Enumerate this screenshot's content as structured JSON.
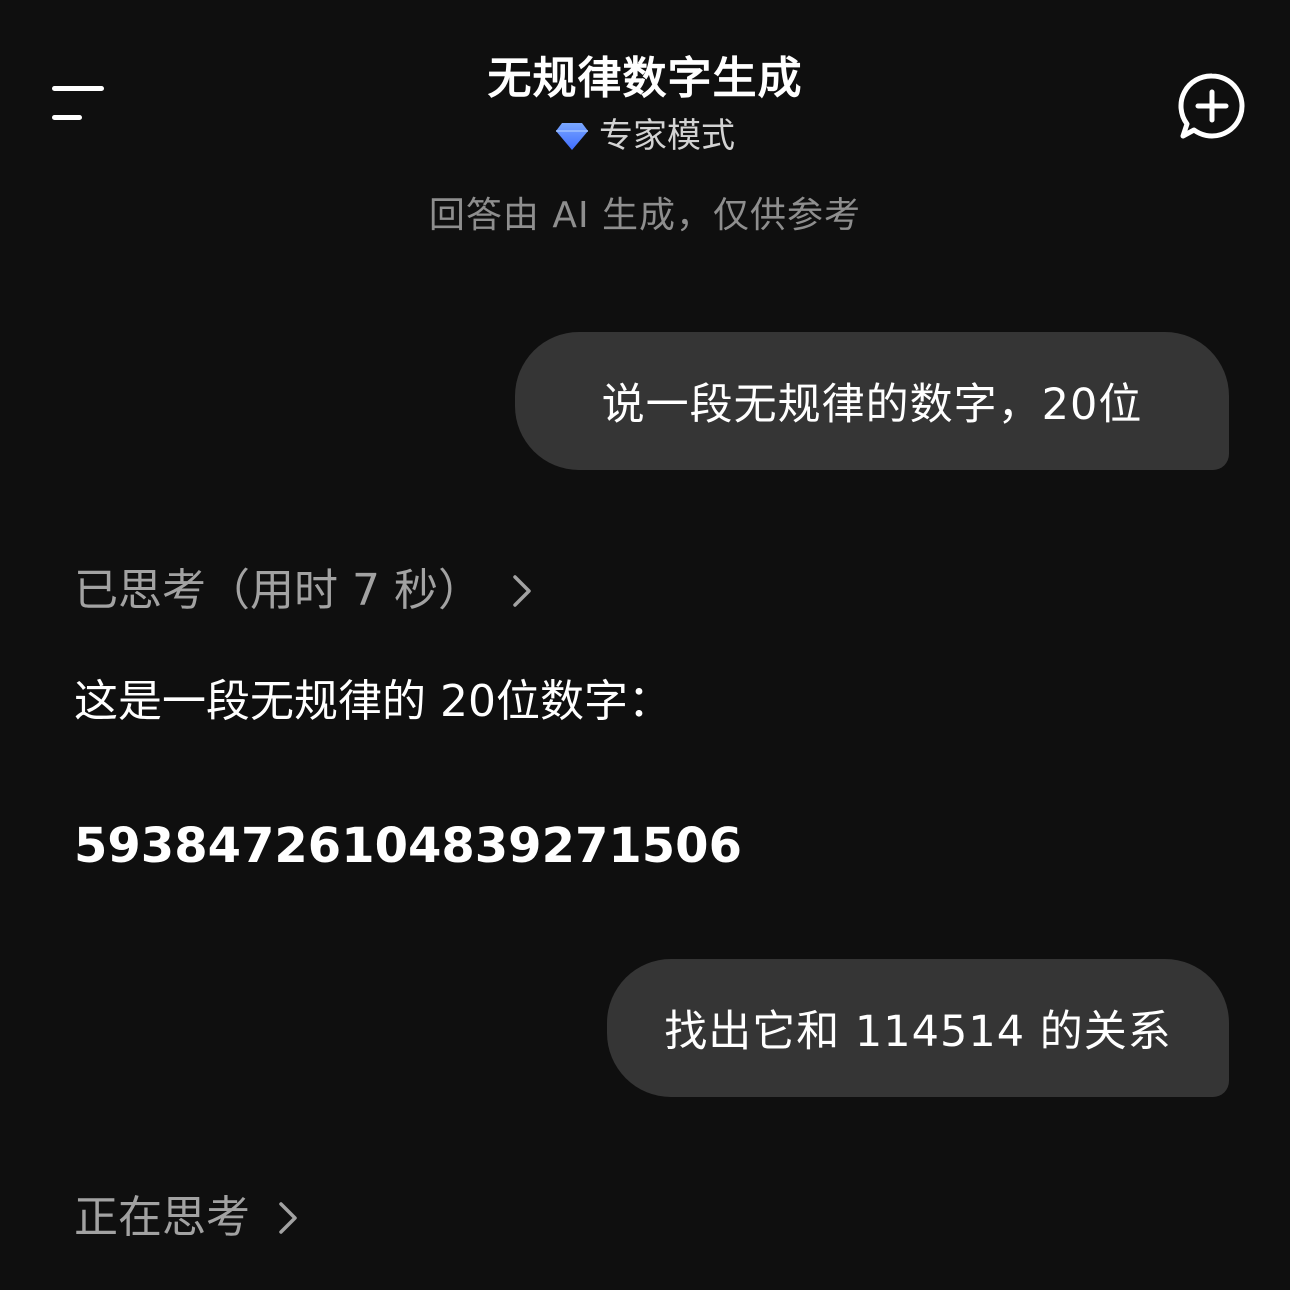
{
  "header": {
    "title": "无规律数字生成",
    "mode_label": "专家模式",
    "menu_icon": "hamburger-menu-icon",
    "mode_icon": "diamond-icon",
    "new_chat_icon": "new-chat-plus-icon"
  },
  "disclaimer": "回答由 AI 生成，仅供参考",
  "messages": [
    {
      "role": "user",
      "text": "说一段无规律的数字，20位"
    },
    {
      "role": "assistant",
      "thinking_label": "已思考（用时 7 秒）",
      "intro": "这是一段无规律的 20位数字：",
      "number": "59384726104839271506"
    },
    {
      "role": "user",
      "text": "找出它和 114514 的关系"
    },
    {
      "role": "assistant",
      "thinking_label": "正在思考"
    }
  ],
  "colors": {
    "background": "#0f0f0f",
    "bubble": "#353535",
    "muted_text": "#8e8e8e",
    "thinking_text": "#a2a2a2",
    "diamond_accent": "#5b8cff"
  }
}
